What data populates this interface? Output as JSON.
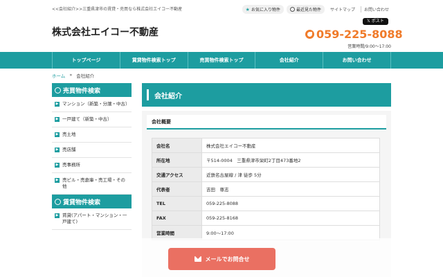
{
  "header": {
    "tagline": "<<会社紹介>>三重県津市の賃貸・売買なら株式会社エイコー不動産",
    "logo": "株式会社エイコー不動産",
    "favorites_label": "お気に入り物件",
    "recent_label": "最近見た物件",
    "sitemap_label": "サイトマップ",
    "contact_link_label": "お問い合わせ",
    "xpost_label": "ポスト",
    "phone": "059-225-8088",
    "hours": "営業時間/9:00～17:00"
  },
  "nav": {
    "items": [
      "トップページ",
      "賃貸物件検索トップ",
      "売買物件検索トップ",
      "会社紹介",
      "お問い合わせ"
    ]
  },
  "breadcrumb": {
    "home": "ホーム",
    "sep": "»",
    "current": "会社紹介"
  },
  "sidebar": {
    "sale_heading": "売買物件検索",
    "sale_items": [
      "マンション（新築・分譲・中古）",
      "一戸建て（新築・中古）",
      "売土地",
      "売店舗",
      "売事務所",
      "売ビル・売倉庫・売工場・その他"
    ],
    "rent_heading": "賃貸物件検索",
    "rent_items": [
      "賃貸(アパート・マンション・一戸建て)"
    ]
  },
  "main": {
    "title": "会社紹介",
    "subheading": "会社概要",
    "rows": [
      {
        "key": "会社名",
        "value": "株式会社エイコー不動産"
      },
      {
        "key": "所在地",
        "value": "〒514-0004　三重県津市栄町2丁目473番地2"
      },
      {
        "key": "交通アクセス",
        "value": "近鉄名古屋線 / 津 徒歩 5分"
      },
      {
        "key": "代表者",
        "value": "吉田　尊志"
      },
      {
        "key": "TEL",
        "value": "059-225-8088"
      },
      {
        "key": "FAX",
        "value": "059-225-8168"
      },
      {
        "key": "営業時間",
        "value": "9:00～17:00"
      }
    ]
  },
  "cta": {
    "label": "メールでお問合せ"
  },
  "colors": {
    "accent": "#1d9da0",
    "phone": "#f07b2a",
    "cta": "#ea7062"
  }
}
